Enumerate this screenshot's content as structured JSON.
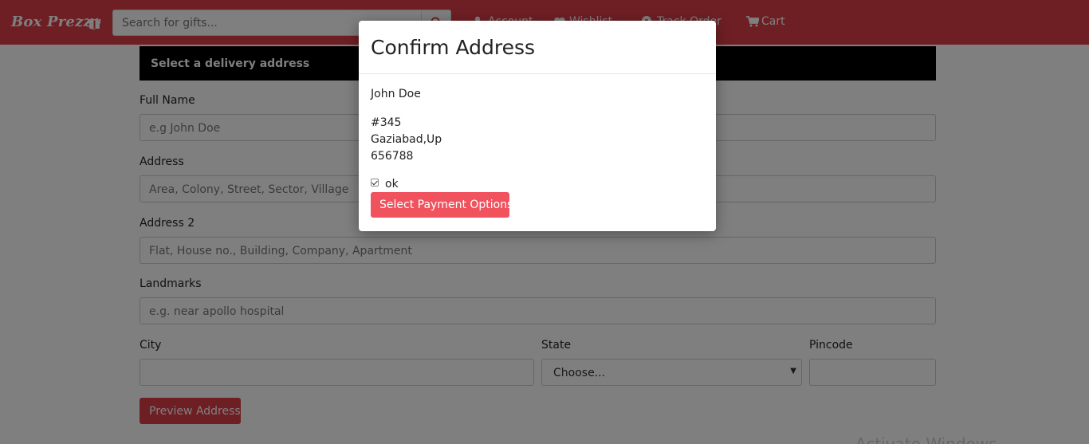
{
  "navbar": {
    "brand": "Box Prezzy",
    "search_placeholder": "Search for gifts...",
    "links": {
      "account": "Account",
      "wishlist": "Wishlist",
      "track_order": "Track Order",
      "cart": "Cart"
    }
  },
  "form": {
    "banner": "Select a delivery address",
    "full_name": {
      "label": "Full Name",
      "placeholder": "e.g John Doe"
    },
    "address": {
      "label": "Address",
      "placeholder": "Area, Colony, Street, Sector, Village"
    },
    "address2": {
      "label": "Address 2",
      "placeholder": "Flat, House no., Building, Company, Apartment"
    },
    "landmarks": {
      "label": "Landmarks",
      "placeholder": "e.g. near apollo hospital"
    },
    "city": {
      "label": "City",
      "value": ""
    },
    "state": {
      "label": "State",
      "selected": "Choose..."
    },
    "pincode": {
      "label": "Pincode",
      "value": ""
    },
    "preview_button": "Preview Address"
  },
  "modal": {
    "title": "Confirm Address",
    "name": "John Doe",
    "address_line1": "#345",
    "address_line2": "Gaziabad,Up",
    "pincode": "656788",
    "checkbox_label": "ok",
    "checkbox_checked": true,
    "payment_button": "Select Payment Options"
  },
  "watermark": "Activate Windows",
  "colors": {
    "brand": "#dc3e48",
    "banner": "#000000",
    "payment_button": "#f0525e"
  }
}
